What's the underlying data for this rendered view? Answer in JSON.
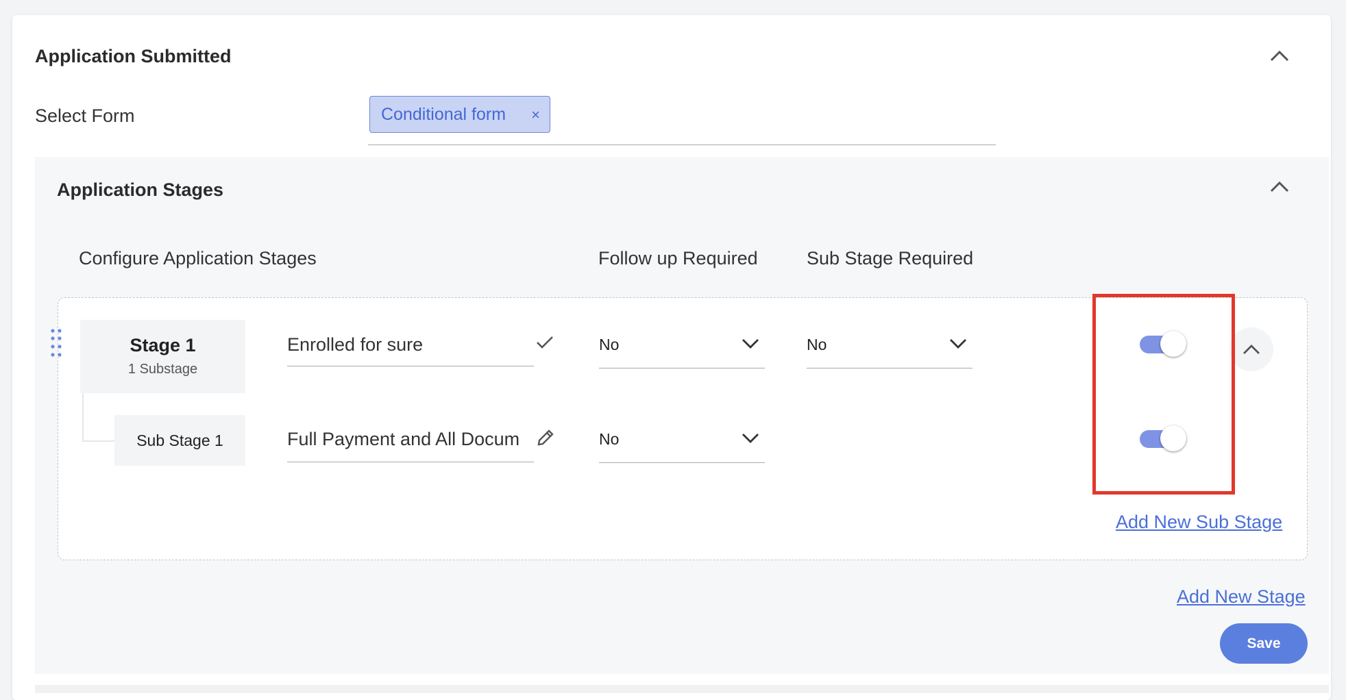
{
  "section": {
    "title": "Application Submitted",
    "select_form_label": "Select Form",
    "selected_form_chip": "Conditional form",
    "chip_remove": "×"
  },
  "stages_panel": {
    "title": "Application Stages",
    "columns": {
      "configure": "Configure Application Stages",
      "follow_up": "Follow up Required",
      "sub_stage": "Sub Stage Required"
    },
    "stage": {
      "name": "Stage 1",
      "substage_count": "1 Substage",
      "input_value": "Enrolled for sure",
      "follow_up_value": "No",
      "sub_stage_value": "No",
      "toggle_on": true
    },
    "substage": {
      "name": "Sub Stage 1",
      "input_value": "Full Payment and All Docum",
      "follow_up_value": "No",
      "toggle_on": true
    },
    "add_sub_stage_link": "Add New Sub Stage",
    "add_stage_link": "Add New Stage",
    "save_label": "Save"
  },
  "colors": {
    "accent": "#5b7fde",
    "chip_bg": "#c9d4f4",
    "highlight": "#e2382c"
  }
}
